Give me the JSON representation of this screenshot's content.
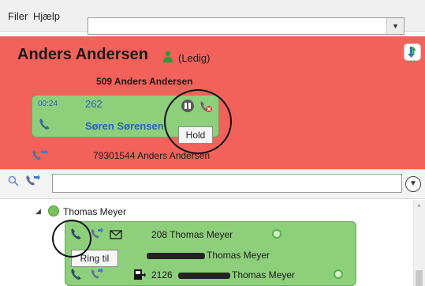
{
  "menu": {
    "file": "Filer",
    "help": "Hjælp"
  },
  "user": {
    "name": "Anders Andersen",
    "status": "(Ledig)",
    "extension_line": "509 Anders Andersen"
  },
  "active_call": {
    "duration": "00:24",
    "number": "262",
    "name": "Søren Sørensen",
    "hold_tooltip": "Hold"
  },
  "forward": {
    "text": "79301544 Anders Andersen"
  },
  "search": {
    "placeholder": ""
  },
  "contacts": {
    "group_name": "Thomas Meyer",
    "rows": [
      {
        "text": "208 Thomas Meyer"
      },
      {
        "text": "Thomas Meyer"
      },
      {
        "prefix": "2126",
        "text": "Thomas Meyer"
      }
    ],
    "ring_tooltip": "Ring til"
  },
  "colors": {
    "header_red": "#f2625a",
    "card_green": "#8ecf7c",
    "link_blue": "#2e63b7"
  }
}
